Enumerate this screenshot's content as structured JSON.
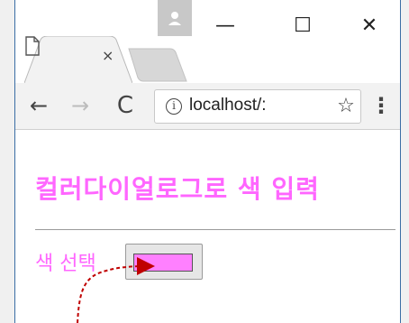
{
  "browser": {
    "tab": {
      "close_glyph": "×",
      "icon": "document-icon"
    },
    "window_controls": {
      "minimize": "—",
      "maximize": "☐",
      "close": "✕"
    },
    "toolbar": {
      "back_glyph": "←",
      "forward_glyph": "→",
      "reload_glyph": "C",
      "address": {
        "info_glyph": "i",
        "url": "localhost/:",
        "star_glyph": "☆"
      },
      "menu_glyph": "⋮"
    }
  },
  "page": {
    "heading": "컬러다이얼로그로 색 입력",
    "color_label": "색 선택",
    "color_input": {
      "value": "#ff80ff"
    }
  },
  "colors": {
    "accent_text": "#ff66ff",
    "swatch": "#ff80ff",
    "annotation_arrow": "#c00000"
  }
}
